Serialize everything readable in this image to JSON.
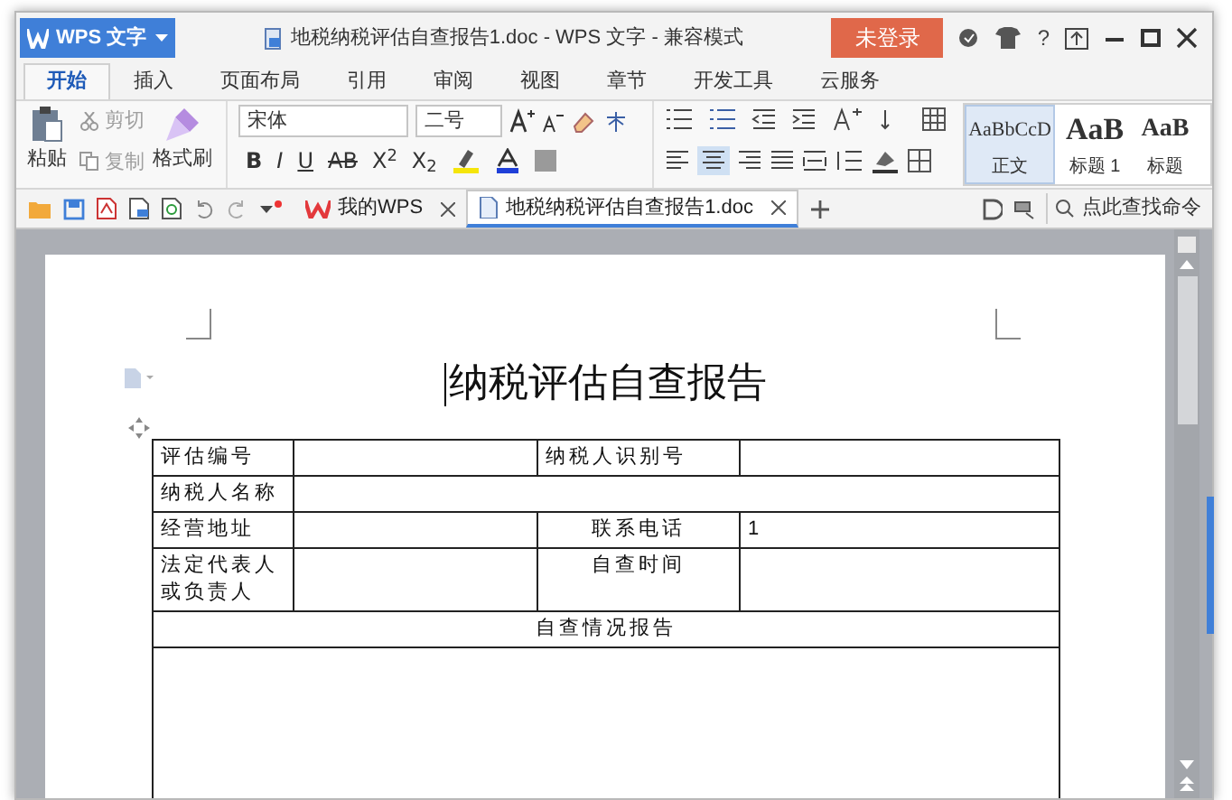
{
  "app_menu": {
    "label": "WPS 文字"
  },
  "window": {
    "title": "地税纳税评估自查报告1.doc - WPS 文字 - 兼容模式"
  },
  "login_button": {
    "label": "未登录"
  },
  "help": {
    "label": "?"
  },
  "ribbon_tabs": [
    {
      "label": "开始",
      "selected": true
    },
    {
      "label": "插入",
      "selected": false
    },
    {
      "label": "页面布局",
      "selected": false
    },
    {
      "label": "引用",
      "selected": false
    },
    {
      "label": "审阅",
      "selected": false
    },
    {
      "label": "视图",
      "selected": false
    },
    {
      "label": "章节",
      "selected": false
    },
    {
      "label": "开发工具",
      "selected": false
    },
    {
      "label": "云服务",
      "selected": false
    }
  ],
  "clipboard": [
    {
      "label": "剪切",
      "disabled": true
    },
    {
      "label": "复制",
      "disabled": true
    }
  ],
  "paste": {
    "label": "粘贴"
  },
  "format_painter": {
    "label": "格式刷"
  },
  "font": {
    "value": "宋体"
  },
  "font_size": {
    "value": "二号"
  },
  "format_buttons": [
    "B",
    "I",
    "U",
    "AB",
    "X$^{2}$",
    "X$_{2}$"
  ],
  "styles": [
    {
      "preview": "AaBbCcD",
      "label": "正文",
      "selected": true
    },
    {
      "preview": "AaB",
      "label": "标题 1",
      "selected": false
    },
    {
      "preview": "AaB",
      "label": "标题",
      "selected": false
    }
  ],
  "doc_tabs": [
    {
      "label": "我的WPS",
      "selected": false
    },
    {
      "label": "地税纳税评估自查报告1.doc",
      "selected": true
    }
  ],
  "command_search": {
    "placeholder": "点此查找命令"
  },
  "document": {
    "title": "纳税评估自查报告",
    "rows": [
      [
        {
          "text": "评估编号"
        },
        {
          "text": ""
        },
        {
          "text": "纳税人识别号"
        },
        {
          "text": ""
        }
      ],
      [
        {
          "text": "纳税人名称"
        },
        {
          "text": "",
          "colspan": 3
        }
      ],
      [
        {
          "text": "经营地址"
        },
        {
          "text": ""
        },
        {
          "text": "联系电话"
        },
        {
          "text": "1"
        }
      ],
      [
        {
          "text": "法定代表人或负责人"
        },
        {
          "text": ""
        },
        {
          "text": "自查时间"
        },
        {
          "text": ""
        }
      ],
      [
        {
          "text": "自查情况报告",
          "colspan": 4
        }
      ]
    ]
  }
}
